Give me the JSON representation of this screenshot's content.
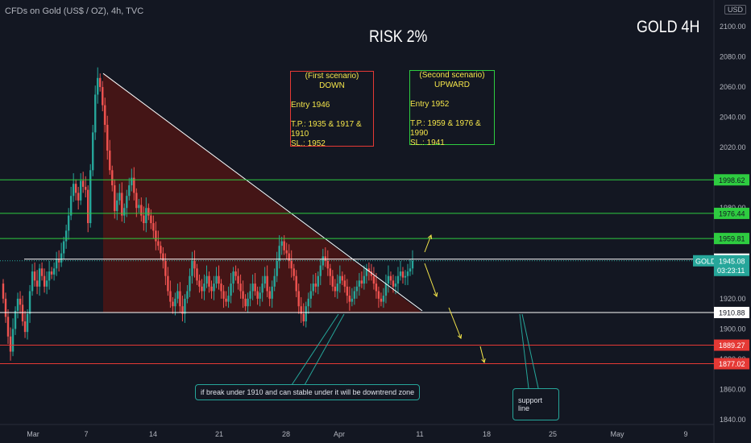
{
  "header": {
    "symbol": "CFDs on Gold (US$ / OZ), 4h, TVC",
    "currency": "USD"
  },
  "annotations": {
    "risk": "RISK 2%",
    "timeframe": "GOLD 4H",
    "scenario1": {
      "title": "(First scenario)",
      "direction": "DOWN",
      "entry": "Entry 1946",
      "tp": "T.P.: 1935 & 1917 & 1910",
      "sl": "SL.: 1952"
    },
    "scenario2": {
      "title": "(Second scenario)",
      "direction": "UPWARD",
      "entry": "Entry 1952",
      "tp": "T.P.: 1959 & 1976 & 1990",
      "sl": "SL.: 1941"
    },
    "note_breakdown": "if break under 1910 and can stable under it will be downtrend zone",
    "note_support": "support line"
  },
  "colors": {
    "background": "#131722",
    "up": "#26a69a",
    "down": "#ef5350",
    "green_line": "#2ecc40",
    "red_line": "#e53935",
    "white_line": "#ffffff",
    "zone": "#4a1515",
    "arrow": "#f5e64a",
    "price_badge": "#26a69a"
  },
  "chart_data": {
    "type": "candlestick",
    "x_ticks": [
      "Mar",
      "7",
      "14",
      "21",
      "28",
      "Apr",
      "11",
      "18",
      "25",
      "May",
      "9"
    ],
    "y_ticks": [
      1840,
      1860,
      1880,
      1900,
      1920,
      1940,
      1960,
      1980,
      2000,
      2020,
      2040,
      2060,
      2080,
      2100
    ],
    "ylim": [
      1838,
      2103
    ],
    "price_lines": [
      {
        "label": "1998.62",
        "value": 1998.62,
        "color": "green"
      },
      {
        "label": "1976.44",
        "value": 1976.44,
        "color": "green"
      },
      {
        "label": "1959.81",
        "value": 1959.81,
        "color": "green"
      },
      {
        "label": "1946.18",
        "value": 1946.18,
        "color": "white"
      },
      {
        "label": "1910.88",
        "value": 1910.88,
        "color": "white"
      },
      {
        "label": "1889.27",
        "value": 1889.27,
        "color": "red"
      },
      {
        "label": "1877.02",
        "value": 1877.02,
        "color": "red"
      }
    ],
    "current_price": {
      "symbol": "GOLD",
      "value": "1945.08",
      "countdown": "03:23:11"
    },
    "trendline": {
      "from": [
        "7",
        2069
      ],
      "to": [
        "11",
        1912
      ]
    },
    "closes": [
      1920,
      1908,
      1895,
      1885,
      1900,
      1912,
      1920,
      1916,
      1905,
      1898,
      1910,
      1925,
      1938,
      1932,
      1928,
      1940,
      1935,
      1928,
      1932,
      1938,
      1936,
      1940,
      1946,
      1944,
      1950,
      1958,
      1965,
      1975,
      1988,
      1996,
      1990,
      1985,
      1998,
      1994,
      1992,
      1970,
      2005,
      2030,
      2055,
      2066,
      2060,
      2048,
      2035,
      2018,
      2005,
      1995,
      1978,
      1985,
      1990,
      1975,
      1980,
      1988,
      1995,
      2000,
      1990,
      1980,
      1982,
      1975,
      1970,
      1980,
      1975,
      1970,
      1965,
      1958,
      1955,
      1950,
      1945,
      1935,
      1925,
      1918,
      1915,
      1920,
      1925,
      1915,
      1910,
      1920,
      1925,
      1935,
      1945,
      1940,
      1932,
      1928,
      1925,
      1930,
      1935,
      1928,
      1925,
      1930,
      1935,
      1930,
      1925,
      1920,
      1918,
      1922,
      1930,
      1938,
      1935,
      1930,
      1925,
      1920,
      1915,
      1920,
      1925,
      1930,
      1925,
      1920,
      1924,
      1930,
      1935,
      1925,
      1920,
      1928,
      1935,
      1945,
      1955,
      1958,
      1952,
      1950,
      1945,
      1940,
      1935,
      1925,
      1915,
      1910,
      1905,
      1915,
      1920,
      1925,
      1930,
      1928,
      1935,
      1942,
      1948,
      1945,
      1940,
      1935,
      1928,
      1925,
      1930,
      1935,
      1932,
      1928,
      1922,
      1918,
      1920,
      1925,
      1928,
      1932,
      1930,
      1935,
      1940,
      1938,
      1935,
      1930,
      1925,
      1920,
      1918,
      1922,
      1930,
      1935,
      1932,
      1928,
      1930,
      1935,
      1938,
      1934,
      1935,
      1938,
      1940,
      1945
    ]
  }
}
